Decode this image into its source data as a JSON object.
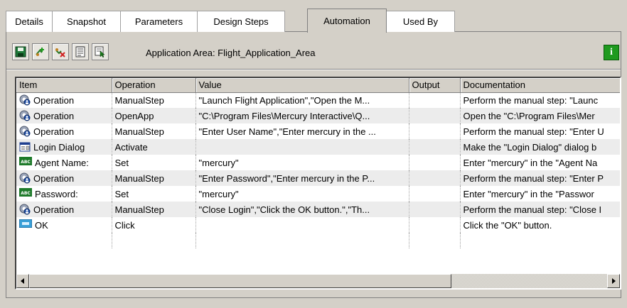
{
  "tabs": [
    {
      "label": "Details"
    },
    {
      "label": "Snapshot"
    },
    {
      "label": "Parameters"
    },
    {
      "label": "Design Steps"
    },
    {
      "label": "Automation"
    },
    {
      "label": "Used By"
    }
  ],
  "active_tab": "Automation",
  "toolbar": {
    "buttons": [
      {
        "icon": "save-icon"
      },
      {
        "icon": "add-step-icon"
      },
      {
        "icon": "delete-step-icon"
      },
      {
        "icon": "properties-icon"
      },
      {
        "icon": "select-object-icon"
      }
    ],
    "application_area_text": "Application Area: Flight_Application_Area",
    "info_label": "i"
  },
  "grid": {
    "columns": [
      "Item",
      "Operation",
      "Value",
      "Output",
      "Documentation"
    ],
    "rows": [
      {
        "icon": "operation-icon",
        "item": "Operation",
        "operation": "ManualStep",
        "value": "\"Launch Flight Application\",\"Open the M...",
        "output": "",
        "documentation": "Perform the manual step: \"Launc"
      },
      {
        "icon": "operation-icon",
        "item": "Operation",
        "operation": "OpenApp",
        "value": "\"C:\\Program Files\\Mercury Interactive\\Q...",
        "output": "",
        "documentation": "Open the  \"C:\\Program Files\\Mer"
      },
      {
        "icon": "operation-icon",
        "item": "Operation",
        "operation": "ManualStep",
        "value": "\"Enter User Name\",\"Enter mercury in the ...",
        "output": "",
        "documentation": "Perform the manual step: \"Enter U"
      },
      {
        "icon": "dialog-icon",
        "item": "Login Dialog",
        "operation": "Activate",
        "value": "",
        "output": "",
        "documentation": "Make the \"Login Dialog\" dialog b"
      },
      {
        "icon": "edit-field-icon",
        "item": "Agent Name:",
        "operation": "Set",
        "value": "\"mercury\"",
        "output": "",
        "documentation": "Enter \"mercury\" in the \"Agent Na"
      },
      {
        "icon": "operation-icon",
        "item": "Operation",
        "operation": "ManualStep",
        "value": "\"Enter Password\",\"Enter mercury in the P...",
        "output": "",
        "documentation": "Perform the manual step: \"Enter P"
      },
      {
        "icon": "edit-field-icon",
        "item": "Password:",
        "operation": "Set",
        "value": "\"mercury\"",
        "output": "",
        "documentation": "Enter \"mercury\" in the \"Passwor"
      },
      {
        "icon": "operation-icon",
        "item": "Operation",
        "operation": "ManualStep",
        "value": "\"Close Login\",\"Click the OK button.\",\"Th...",
        "output": "",
        "documentation": "Perform the manual step: \"Close I"
      },
      {
        "icon": "button-object-icon",
        "item": "OK",
        "operation": "Click",
        "value": "",
        "output": "",
        "documentation": "Click the \"OK\" button."
      }
    ]
  },
  "scrollbar": {
    "left_arrow_icon": "scroll-left-icon",
    "right_arrow_icon": "scroll-right-icon"
  }
}
